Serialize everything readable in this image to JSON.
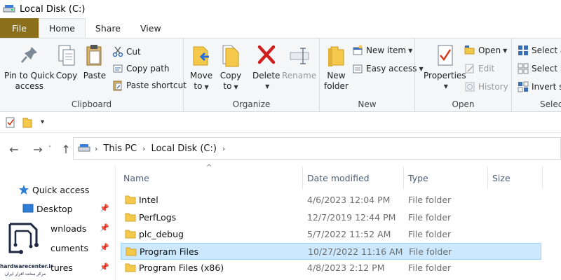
{
  "window": {
    "title": "Local Disk (C:)"
  },
  "tabs": [
    {
      "label": "File"
    },
    {
      "label": "Home"
    },
    {
      "label": "Share"
    },
    {
      "label": "View"
    }
  ],
  "ribbon": {
    "clipboard": {
      "label": "Clipboard",
      "pin_label_1": "Pin to Quick",
      "pin_label_2": "access",
      "copy": "Copy",
      "paste": "Paste",
      "cut": "Cut",
      "copy_path": "Copy path",
      "paste_shortcut": "Paste shortcut"
    },
    "organize": {
      "label": "Organize",
      "move_1": "Move",
      "move_2": "to",
      "copy_1": "Copy",
      "copy_2": "to",
      "delete": "Delete",
      "rename": "Rename"
    },
    "new": {
      "label": "New",
      "new_folder_1": "New",
      "new_folder_2": "folder",
      "new_item": "New item",
      "easy_access": "Easy access"
    },
    "open": {
      "label": "Open",
      "properties": "Properties",
      "open": "Open",
      "edit": "Edit",
      "history": "History"
    },
    "select": {
      "label": "Selec",
      "select_all": "Select al",
      "select_none": "Select no",
      "invert": "Invert se"
    }
  },
  "address": {
    "crumbs": [
      "This PC",
      "Local Disk (C:)"
    ]
  },
  "navpane": {
    "items": [
      {
        "label": "Quick access"
      },
      {
        "label": "Desktop"
      },
      {
        "label": "wnloads"
      },
      {
        "label": "cuments"
      },
      {
        "label": "tures"
      }
    ]
  },
  "columns": [
    "Name",
    "Date modified",
    "Type",
    "Size"
  ],
  "files": [
    {
      "name": "Intel",
      "date": "4/6/2023 12:04 PM",
      "type": "File folder"
    },
    {
      "name": "PerfLogs",
      "date": "12/7/2019 12:44 PM",
      "type": "File folder"
    },
    {
      "name": "plc_debug",
      "date": "5/7/2022 11:52 AM",
      "type": "File folder"
    },
    {
      "name": "Program Files",
      "date": "10/27/2022 11:16 AM",
      "type": "File folder"
    },
    {
      "name": "Program Files (x86)",
      "date": "4/8/2023 2:12 PM",
      "type": "File folder"
    }
  ],
  "logo": {
    "text": "hardwarecenter.ir",
    "sub": "مرکز سخت افزار ایران"
  },
  "colors": {
    "file_tab": "#8b6f1a",
    "selection": "#cce8ff",
    "folder": "#f4c84b"
  }
}
